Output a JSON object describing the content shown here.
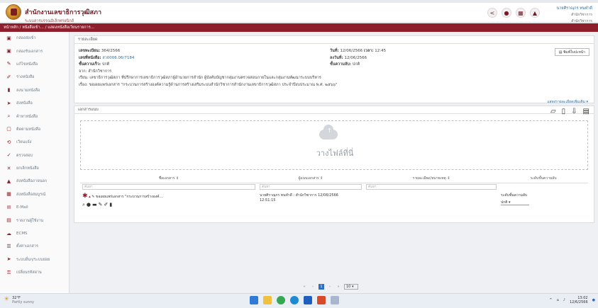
{
  "header": {
    "org_title": "สำนักงานเลขาธิการวุฒิสภา",
    "org_subtitle": "ระบบสารบรรณอิเล็กทรอนิกส์",
    "user_name": "นายศิราณุกร ทนทำดี",
    "user_role": "สำนักวิชาการ",
    "user_role2": "สำนักวิชาการ"
  },
  "breadcrumb": "หน้าหลัก / หนังสือเข้า... / แสดงหนังสือเวียนรายการ...",
  "sidebar": [
    {
      "label": "กล่องส่งเข้า",
      "icon": "inbox-icon"
    },
    {
      "label": "กล่องรับเอกสาร",
      "icon": "inbox-icon"
    },
    {
      "label": "แก้ไขหนังสือ",
      "icon": "pencil-icon"
    },
    {
      "label": "ร่างหนังสือ",
      "icon": "draft-icon"
    },
    {
      "label": "ลงนามหนังสือ",
      "icon": "sign-icon"
    },
    {
      "label": "ส่งหนังสือ",
      "icon": "send-icon"
    },
    {
      "label": "ค้าหาหนังสือ",
      "icon": "search-icon"
    },
    {
      "label": "ติดตามหนังสือ",
      "icon": "track-icon"
    },
    {
      "label": "เวียนแจ้ง",
      "icon": "share-icon"
    },
    {
      "label": "ตรวจสอบ",
      "icon": "check-icon"
    },
    {
      "label": "ยกเลิกหนังสือ",
      "icon": "cancel-icon"
    },
    {
      "label": "ส่งหนังสือภายนอก",
      "icon": "warning-icon"
    },
    {
      "label": "ส่งหนังสือสมบูรณ์",
      "icon": "book-icon"
    },
    {
      "label": "E-Mail",
      "icon": "mail-icon"
    },
    {
      "label": "รายงานผู้ใช้งาน",
      "icon": "report-icon"
    },
    {
      "label": "ECMS",
      "icon": "cloud-icon"
    },
    {
      "label": "ตั้งค่าเอกสาร",
      "icon": "list-icon"
    },
    {
      "label": "ระบบอื่นๆ/ระบบย่อย",
      "icon": "send-icon"
    },
    {
      "label": "เปลี่ยนรหัสผ่าน",
      "icon": "key-icon"
    }
  ],
  "details": {
    "card_title": "รายละเอียด",
    "doc_no_label": "เลขทะเบียน:",
    "doc_no": "364/2566",
    "ref_label": "เลขที่หนังสือ:",
    "ref": "สว0006.06/7184",
    "speed_label": "ชั้นความเร็ว:",
    "speed": "ปกติ",
    "from_label": "จาก:",
    "from": "สำนักวิชาการ",
    "to_label": "เรียน:",
    "to": "เลขาธิการวุฒิสภา ที่ปรึกษาการเลขาธิการวุฒิสภาผู้อำนวยการสำนัก ผู้บังคับบัญชากลุ่มงานตรวจสอบภายในและกลุ่มงานพัฒนาระบบบริหาร",
    "subject_label": "เรื่อง:",
    "subject": "ขอเผยแพร่เอกสาร \"กระบวนการสร้างองค์ความรู้ด้านการสร้างเสริมระบบสำนักวิชาการสำนักงานเลขาธิการวุฒิสภา ประจำปีงบประมาณ พ.ศ. ๒๕๖๖\"",
    "date_label": "วันที่:",
    "date": "12/06/2566",
    "time_label": "เวลา:",
    "time": "12:45",
    "doc_date_label": "ลงวันที่:",
    "doc_date": "12/06/2566",
    "secret_label": "ชั้นความลับ:",
    "secret": "ปกติ",
    "print_button": "พิมพ์ใบปะหน้า",
    "more_link": "แสดงรายละเอียดเพิ่มเติม"
  },
  "files": {
    "card_title": "เอกสารแนบ",
    "drop_text": "วางไฟล์ที่นี่",
    "columns": [
      "ชื่อเอกสาร",
      "ผู้แนบเอกสาร",
      "รายละเอียด/หมายเหตุ",
      "ระดับชั้นความลับ"
    ],
    "filter_placeholders": [
      "ค้นหา",
      "ค้นหา",
      "ค้นหา"
    ],
    "rows": [
      {
        "name": "ขอเผยแพร่เอกสาร \"กระบวนการสร้างองค์...",
        "uploader": "นายศิราณุกร ทนทำดี : สำนักวิชาการ 12/06/2566",
        "uploader_time": "12:51:15",
        "note": "",
        "level_label": "ระดับชั้นความลับ",
        "level_value": "ปกติ"
      }
    ],
    "pager": {
      "current": "1",
      "page_size": "10"
    }
  },
  "taskbar": {
    "weather_temp": "32°F",
    "weather_desc": "Partly sunny",
    "time": "13:02",
    "date": "12/6/2566"
  }
}
